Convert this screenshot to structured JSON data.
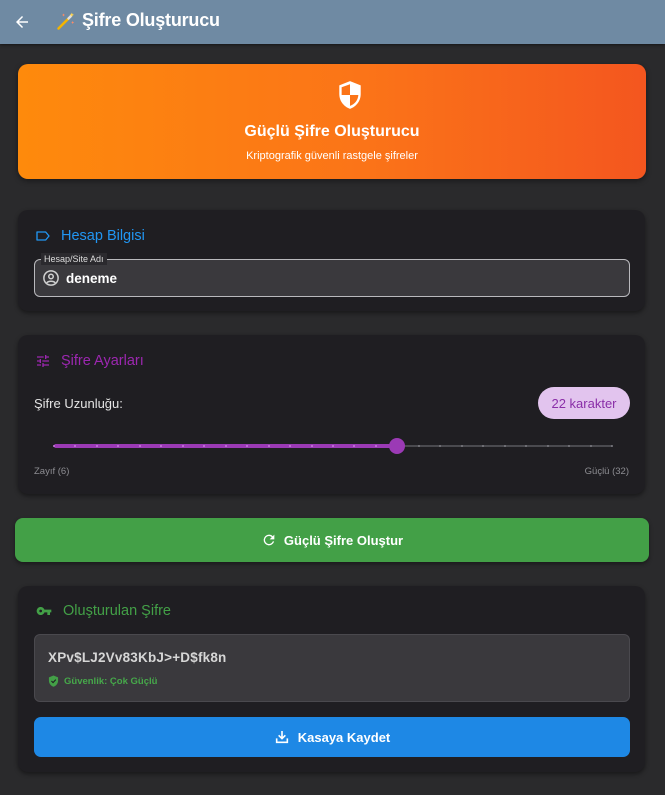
{
  "appbar": {
    "title": "Şifre Oluşturucu",
    "back_icon": "arrow-left-icon",
    "title_icon": "magic-wand-icon",
    "background": "#6f8aa3"
  },
  "hero": {
    "title": "Güçlü Şifre Oluşturucu",
    "subtitle": "Kriptografik güvenli rastgele şifreler",
    "icon": "shield-icon",
    "gradient": [
      "#fe8a0c",
      "#f4561f"
    ]
  },
  "account": {
    "heading": "Hesap Bilgisi",
    "heading_color": "#2196f3",
    "field_label": "Hesap/Site Adı",
    "field_value": "deneme"
  },
  "settings": {
    "heading": "Şifre Ayarları",
    "heading_color": "#9c27b0",
    "length_label": "Şifre Uzunluğu:",
    "length_badge": "22 karakter",
    "slider": {
      "min": 6,
      "max": 32,
      "value": 22
    },
    "min_label": "Zayıf (6)",
    "max_label": "Güçlü (32)"
  },
  "generate_button": {
    "label": "Güçlü Şifre Oluştur",
    "color": "#43a047"
  },
  "result": {
    "heading": "Oluşturulan Şifre",
    "heading_color": "#43a047",
    "password": "XPv$LJ2Vv83KbJ>+D$fk8n",
    "security_text": "Güvenlik: Çok Güçlü",
    "save_label": "Kasaya Kaydet",
    "save_color": "#1e88e5"
  }
}
